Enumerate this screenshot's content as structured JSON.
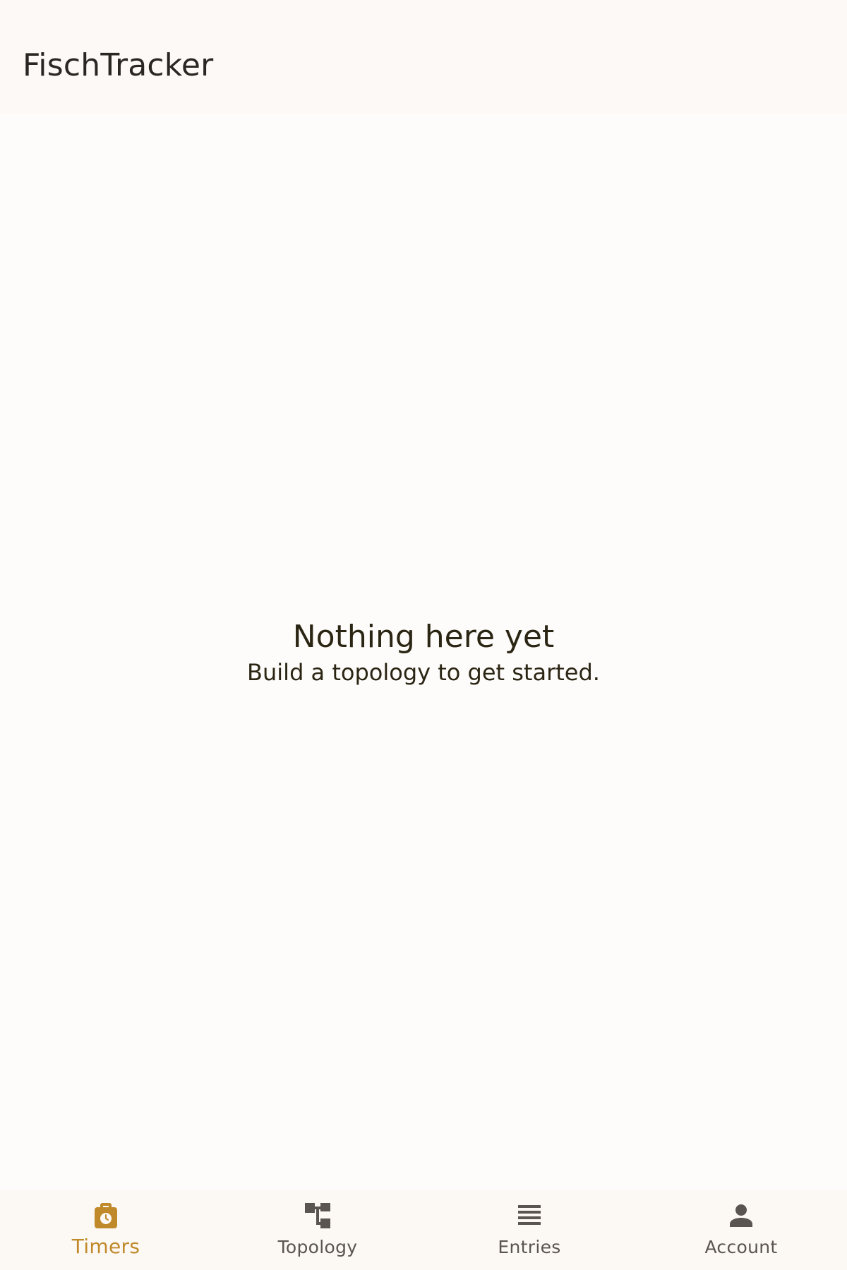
{
  "app": {
    "title": "FischTracker"
  },
  "empty_state": {
    "title": "Nothing here yet",
    "subtitle": "Build a topology to get started."
  },
  "bottom_nav": {
    "items": [
      {
        "label": "Timers",
        "icon": "timer-bag-icon",
        "active": true
      },
      {
        "label": "Topology",
        "icon": "topology-icon",
        "active": false
      },
      {
        "label": "Entries",
        "icon": "list-icon",
        "active": false
      },
      {
        "label": "Account",
        "icon": "person-icon",
        "active": false
      }
    ]
  },
  "colors": {
    "accent": "#c08a2a",
    "inactive": "#5a5550",
    "background": "#fefcfa",
    "app_bar": "#fdf9f6"
  }
}
